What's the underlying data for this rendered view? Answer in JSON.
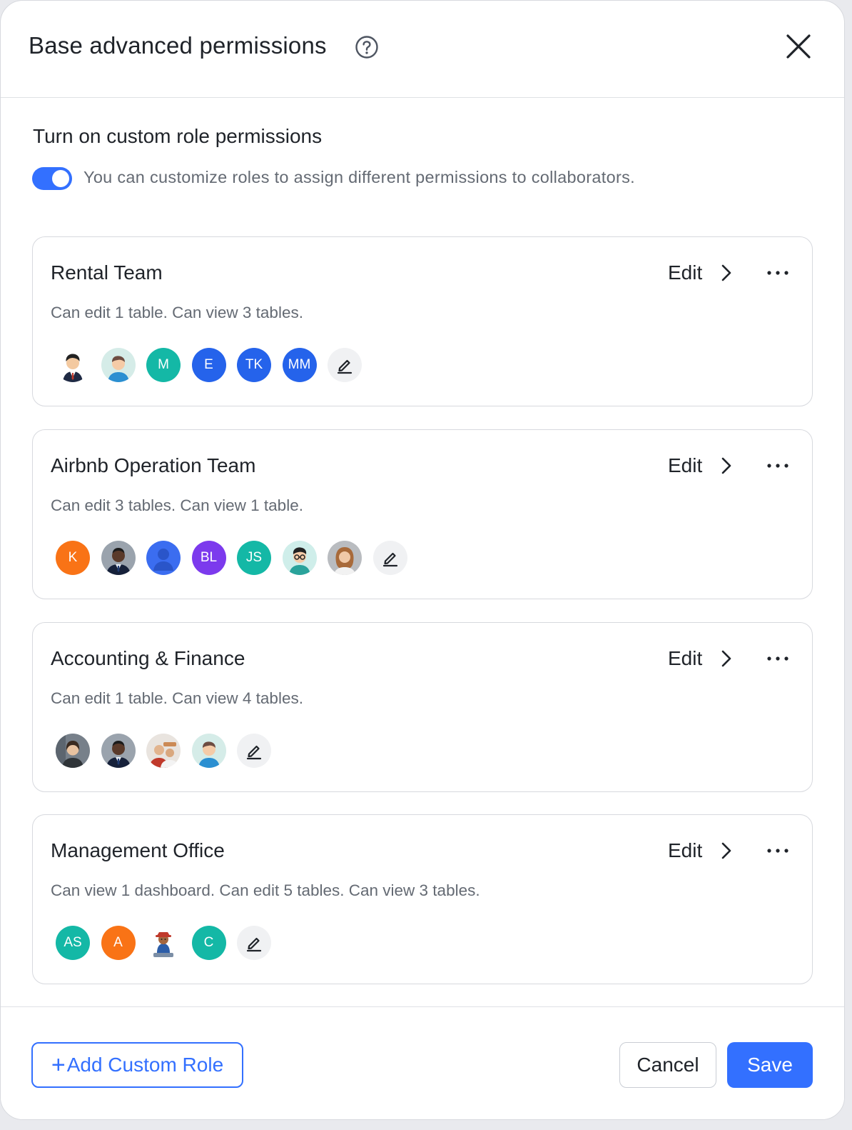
{
  "dialog": {
    "title": "Base advanced permissions",
    "help_icon": "help-circle-icon",
    "close_icon": "close-icon"
  },
  "custom_roles": {
    "section_title": "Turn on custom role permissions",
    "toggle_on": true,
    "toggle_description": "You can customize roles to assign different permissions to collaborators."
  },
  "roles": [
    {
      "name": "Rental Team",
      "edit_label": "Edit",
      "description": "Can edit 1 table. Can view 3 tables.",
      "members": [
        {
          "type": "photo",
          "icon": "man-suit-avatar"
        },
        {
          "type": "photo",
          "icon": "person-cartoon-avatar"
        },
        {
          "type": "initials",
          "text": "M",
          "color": "#14b8a6"
        },
        {
          "type": "initials",
          "text": "E",
          "color": "#2563eb"
        },
        {
          "type": "initials",
          "text": "TK",
          "color": "#2563eb"
        },
        {
          "type": "initials",
          "text": "MM",
          "color": "#2563eb"
        }
      ]
    },
    {
      "name": "Airbnb Operation Team",
      "edit_label": "Edit",
      "description": "Can edit 3 tables. Can view 1 table.",
      "members": [
        {
          "type": "initials",
          "text": "K",
          "color": "#f97316"
        },
        {
          "type": "photo",
          "icon": "man-suit-photo-avatar"
        },
        {
          "type": "photo",
          "icon": "default-user-avatar"
        },
        {
          "type": "initials",
          "text": "BL",
          "color": "#7c3aed"
        },
        {
          "type": "initials",
          "text": "JS",
          "color": "#14b8a6"
        },
        {
          "type": "photo",
          "icon": "man-glasses-avatar"
        },
        {
          "type": "photo",
          "icon": "woman-photo-avatar"
        }
      ]
    },
    {
      "name": "Accounting & Finance",
      "edit_label": "Edit",
      "description": "Can edit 1 table. Can view 4 tables.",
      "members": [
        {
          "type": "photo",
          "icon": "woman-office-photo-avatar"
        },
        {
          "type": "photo",
          "icon": "man-suit-photo-avatar"
        },
        {
          "type": "photo",
          "icon": "people-photo-avatar"
        },
        {
          "type": "photo",
          "icon": "person-cartoon-avatar"
        }
      ]
    },
    {
      "name": "Management Office",
      "edit_label": "Edit",
      "description": "Can view 1 dashboard. Can edit 5 tables. Can view 3 tables.",
      "members": [
        {
          "type": "initials",
          "text": "AS",
          "color": "#14b8a6"
        },
        {
          "type": "initials",
          "text": "A",
          "color": "#f97316"
        },
        {
          "type": "photo",
          "icon": "bear-figure-avatar"
        },
        {
          "type": "initials",
          "text": "C",
          "color": "#14b8a6"
        }
      ]
    }
  ],
  "footer": {
    "add_role_icon": "+",
    "add_role_label": "Add Custom Role",
    "cancel_label": "Cancel",
    "save_label": "Save"
  },
  "colors": {
    "accent": "#3370ff",
    "text_primary": "#1f2329",
    "text_secondary": "#646a73",
    "border": "#d7d9de"
  }
}
